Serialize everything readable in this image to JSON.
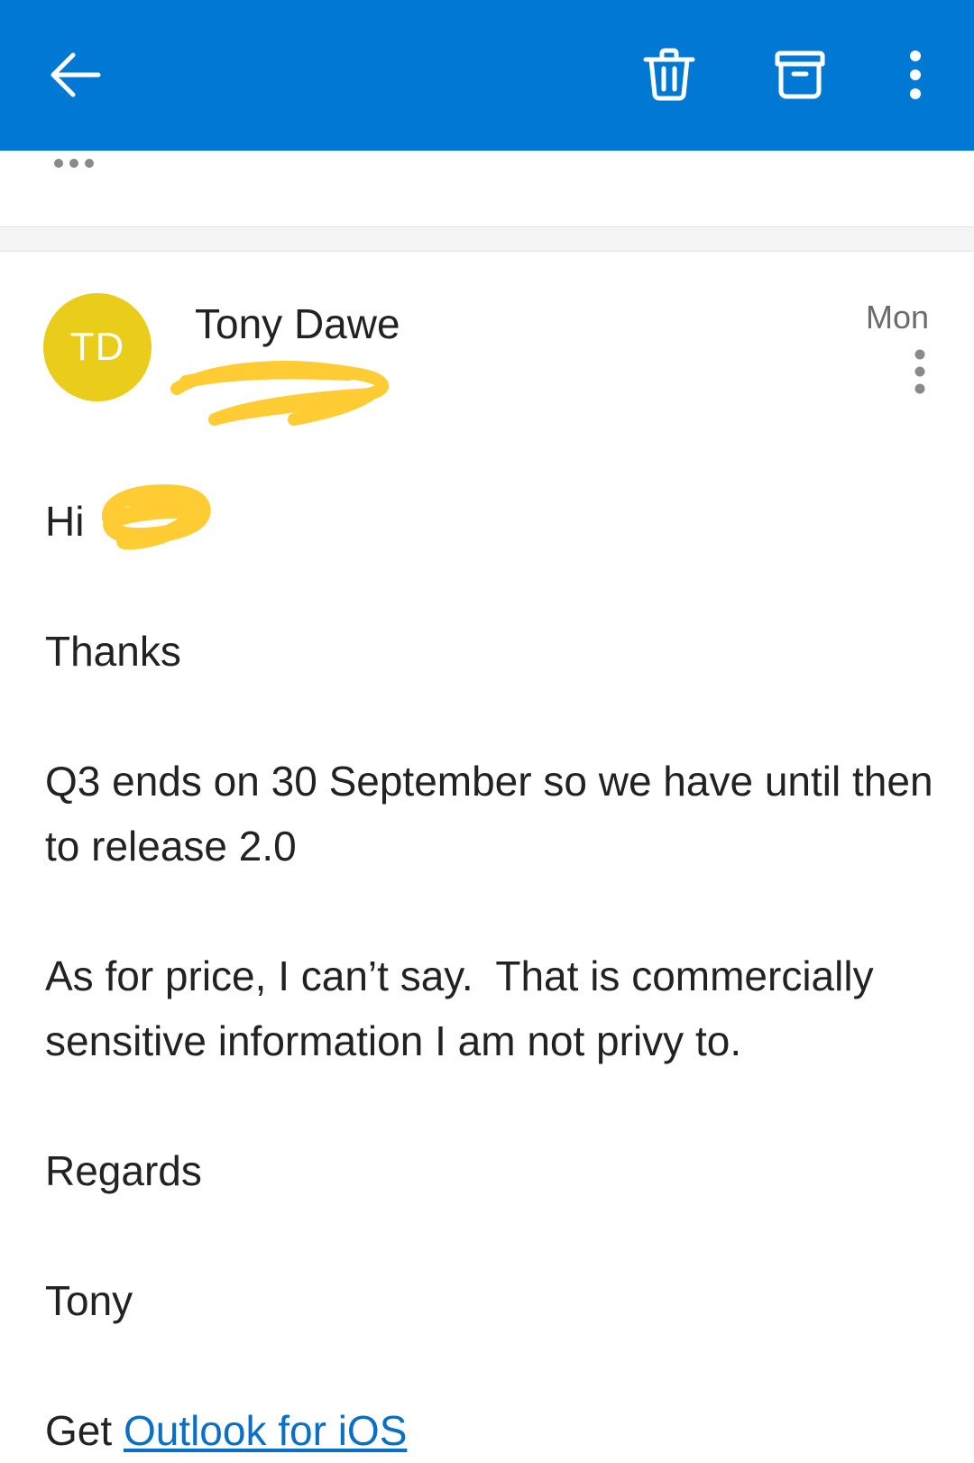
{
  "colors": {
    "topbar": "#0078d4",
    "avatar": "#eacc1b",
    "link": "#0a6fc7",
    "redaction": "#ffcc33"
  },
  "toolbar": {
    "back_icon": "arrow-left-icon",
    "delete_icon": "trash-icon",
    "archive_icon": "archive-icon",
    "more_icon": "more-vertical-icon"
  },
  "message": {
    "avatar_initials": "TD",
    "sender_name": "Tony Dawe",
    "date": "Mon",
    "greeting": "Hi",
    "paragraphs": [
      "Thanks",
      "Q3 ends on 30 September so we have until then to release 2.0",
      "As for price, I can’t say.  That is commercially sensitive information I am not privy to.",
      "Regards",
      "Tony"
    ],
    "footer_prefix": "Get ",
    "footer_link": "Outlook for iOS"
  }
}
